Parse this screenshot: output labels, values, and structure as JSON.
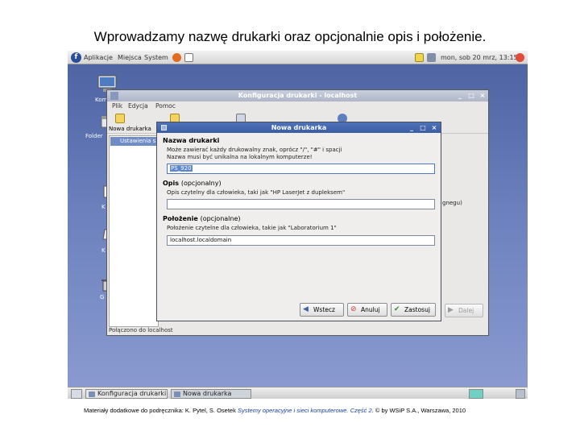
{
  "slide": {
    "title": "Wprowadzamy nazwę drukarki oraz opcjonalnie opis i położenie.",
    "footer_pre": "Materiały dodatkowe do podręcznika: K. Pytel, S. Osetek ",
    "footer_italic": "Systemy operacyjne i sieci komputerowe. Część 2",
    "footer_post": ". © by WSiP S.A., Warszawa, 2010"
  },
  "top_panel": {
    "menu": [
      "Aplikacje",
      "Miejsca",
      "System"
    ],
    "clock": "mon, sob 20 mrz, 13:15"
  },
  "desktop": {
    "labels": [
      "Kom",
      "Folder",
      "K",
      "K",
      "G"
    ]
  },
  "parent_window": {
    "title": "Konfiguracja drukarki - localhost",
    "menu": [
      "Plik",
      "Edycja",
      "Pomoc"
    ],
    "toolbar_new": "Nowa drukarka",
    "list_selected": "Ustawienia s",
    "side_text": "gnegu)",
    "status": "Połączono do localhost"
  },
  "dialog": {
    "title": "Nowa drukarka",
    "name_heading": "Nazwa drukarki",
    "name_desc_1": "Może zawierać każdy drukowalny znak, oprócz \"/\", \"#\" i spacji",
    "name_desc_2": "Nazwa musi być unikalna na lokalnym komputerze!",
    "name_value": "PS_920",
    "desc_heading": "Opis",
    "desc_optional": "(opcjonalny)",
    "desc_desc": "Opis czytelny dla człowieka, taki jak \"HP LaserJet z dupleksem\"",
    "desc_value": "",
    "loc_heading": "Położenie",
    "loc_optional": "(opcjonalne)",
    "loc_desc": "Położenie czytelne dla człowieka, takie jak \"Laboratorium 1\"",
    "loc_value": "localhost.localdomain",
    "buttons": {
      "back": "Wstecz",
      "cancel": "Anuluj",
      "apply": "Zastosuj",
      "forward": "Dalej"
    }
  },
  "taskbar": {
    "task1": "Konfiguracja drukarki",
    "task2": "Nowa drukarka"
  },
  "colors": {
    "desktop": "#5a6fa8",
    "dialog_titlebar": "#3a5da4",
    "selection": "#5c86cf"
  }
}
